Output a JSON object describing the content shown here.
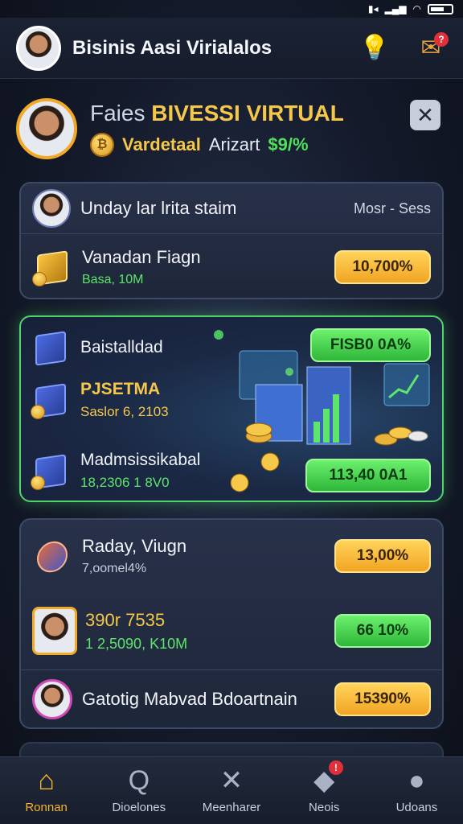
{
  "app": {
    "title": "Bisinis Aasi Virialalos"
  },
  "profile": {
    "title_light": "Faies",
    "title_gold": "BIVESSI VIRTUAL",
    "sub_label": "Vardetaal",
    "sub_text": "Arizart",
    "sub_value": "$9/%"
  },
  "panel1": {
    "header": {
      "title": "Unday lar lrita staim",
      "right": "Mosr - Sess"
    },
    "row": {
      "title": "Vanadan Fiagn",
      "sub": "Basa, 10M",
      "pill": "10,700%"
    }
  },
  "hero": {
    "items": [
      {
        "title": "Baistalldad",
        "sub": ""
      },
      {
        "title": "PJSETMA",
        "sub": "Saslor 6, 2103"
      },
      {
        "title": "Madmsissikabal",
        "sub": "18,2306 1 8V0"
      }
    ],
    "pill_top": "FISB0 0A%",
    "pill_bottom": "113,40 0A1"
  },
  "panel2": {
    "rows": [
      {
        "title": "Raday, Viugn",
        "sub": "7,oomel4%",
        "pill": "13,00%"
      },
      {
        "title": "390r 7535",
        "sub": "1 2,5090, K10M",
        "pill": "66 10%"
      }
    ]
  },
  "panel3": {
    "title": "Gatotig Mabvad Bdoartnain",
    "pill": "15390%"
  },
  "nav": [
    {
      "label": "Ronnan",
      "icon": "home-icon",
      "glyph": "⌂"
    },
    {
      "label": "Dioelones",
      "icon": "search-icon",
      "glyph": "Q"
    },
    {
      "label": "Meenharer",
      "icon": "tools-icon",
      "glyph": "✕"
    },
    {
      "label": "Neois",
      "icon": "box-icon",
      "glyph": "◆"
    },
    {
      "label": "Udoans",
      "icon": "user-icon",
      "glyph": "●"
    }
  ],
  "colors": {
    "accent_gold": "#f6c84a",
    "accent_green": "#4fe05d",
    "background": "#141a2a"
  }
}
